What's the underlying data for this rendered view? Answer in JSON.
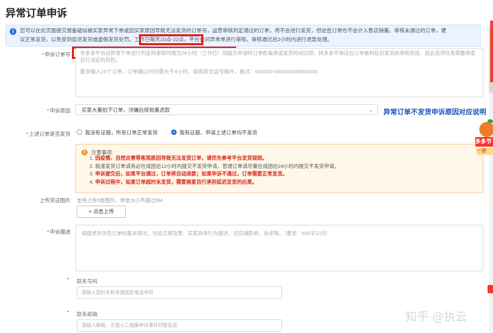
{
  "page": {
    "title": "异常订单申诉"
  },
  "notice": {
    "line1": "您可以在此页面提交报备疑似被买家异常下单或因买家原因导致无法发货的订单号，运营审核判定通过的订单，将不会进行发货，但这些订单也不会计入售店销量。审核未通过的订单，建",
    "line2": "议正常发货，以免受到延迟发货或虚假发货处罚。工作日每天10点-22点，平台会对异常单进行审核，审核通过后2小时内进行退款处理。"
  },
  "form": {
    "order_label": "申诉订单号",
    "order_desc": "非多多平台对异常下单进行判定的审核时限为24小时（工作日）同提交申请时订单距离承诺发货时间过短，拼多多不保证在订单被判延迟发货前审核完成，因此选项任务需要商家自行决定的风险。",
    "order_placeholder": "最多输入20个订单，订单确认时间需大于4小时，请用英文逗号隔开，格式：000000-000000000000000",
    "reason_label": "申诉原因",
    "reason_value": "买家大量拍下订单，涉嫌后续批量退款",
    "reason_link": "异常订单不发货申诉原因对应说明",
    "shipped_label": "上述订单是否发货",
    "radio_no": "我没有证据，所有订单正常发货",
    "radio_yes": "我有证据，申请上述订单均不发货",
    "upload_label": "上传凭证图片",
    "upload_hint": "支持上传5张图片，单张大小不超过5M",
    "upload_button": "+ 点击上传",
    "desc_label": "申诉描述",
    "desc_placeholder": "请描述所涉及订单的基本情况，包括交易背景、买家具体行为描述、对店铺影响、诉求等。（要求：600字以内）",
    "phone_label": "联系号码",
    "phone_placeholder": "请输入您的手机号或固定电话号码",
    "email_label": "联系邮箱",
    "email_placeholder": "请输入邮箱，方便小二就案申诉事件时联系您"
  },
  "warning": {
    "head": "注意事项:",
    "items": [
      "因疫情、自然灾害等客观原因导致无法发货订单，请优先参考平台发货规则。",
      "极速发货订单请务必在成团后12小时内提交不发货申请，普通订单请尽量在成团后24小时内提交不发货申请。",
      "申诉提交后，如果平台通过，订单将自动退款；如果申诉不通过，订单需要正常发货。",
      "申诉过程中，如果订单超时未发货，需要商家自行承担延迟发货的后果。"
    ]
  },
  "side_promo": {
    "tag": "多多节",
    "sub": "一键"
  },
  "watermark": "知乎 @执云",
  "colors": {
    "accent": "#2a6fdb",
    "alert": "#e0201c",
    "warning_bg": "#fff8ea"
  }
}
